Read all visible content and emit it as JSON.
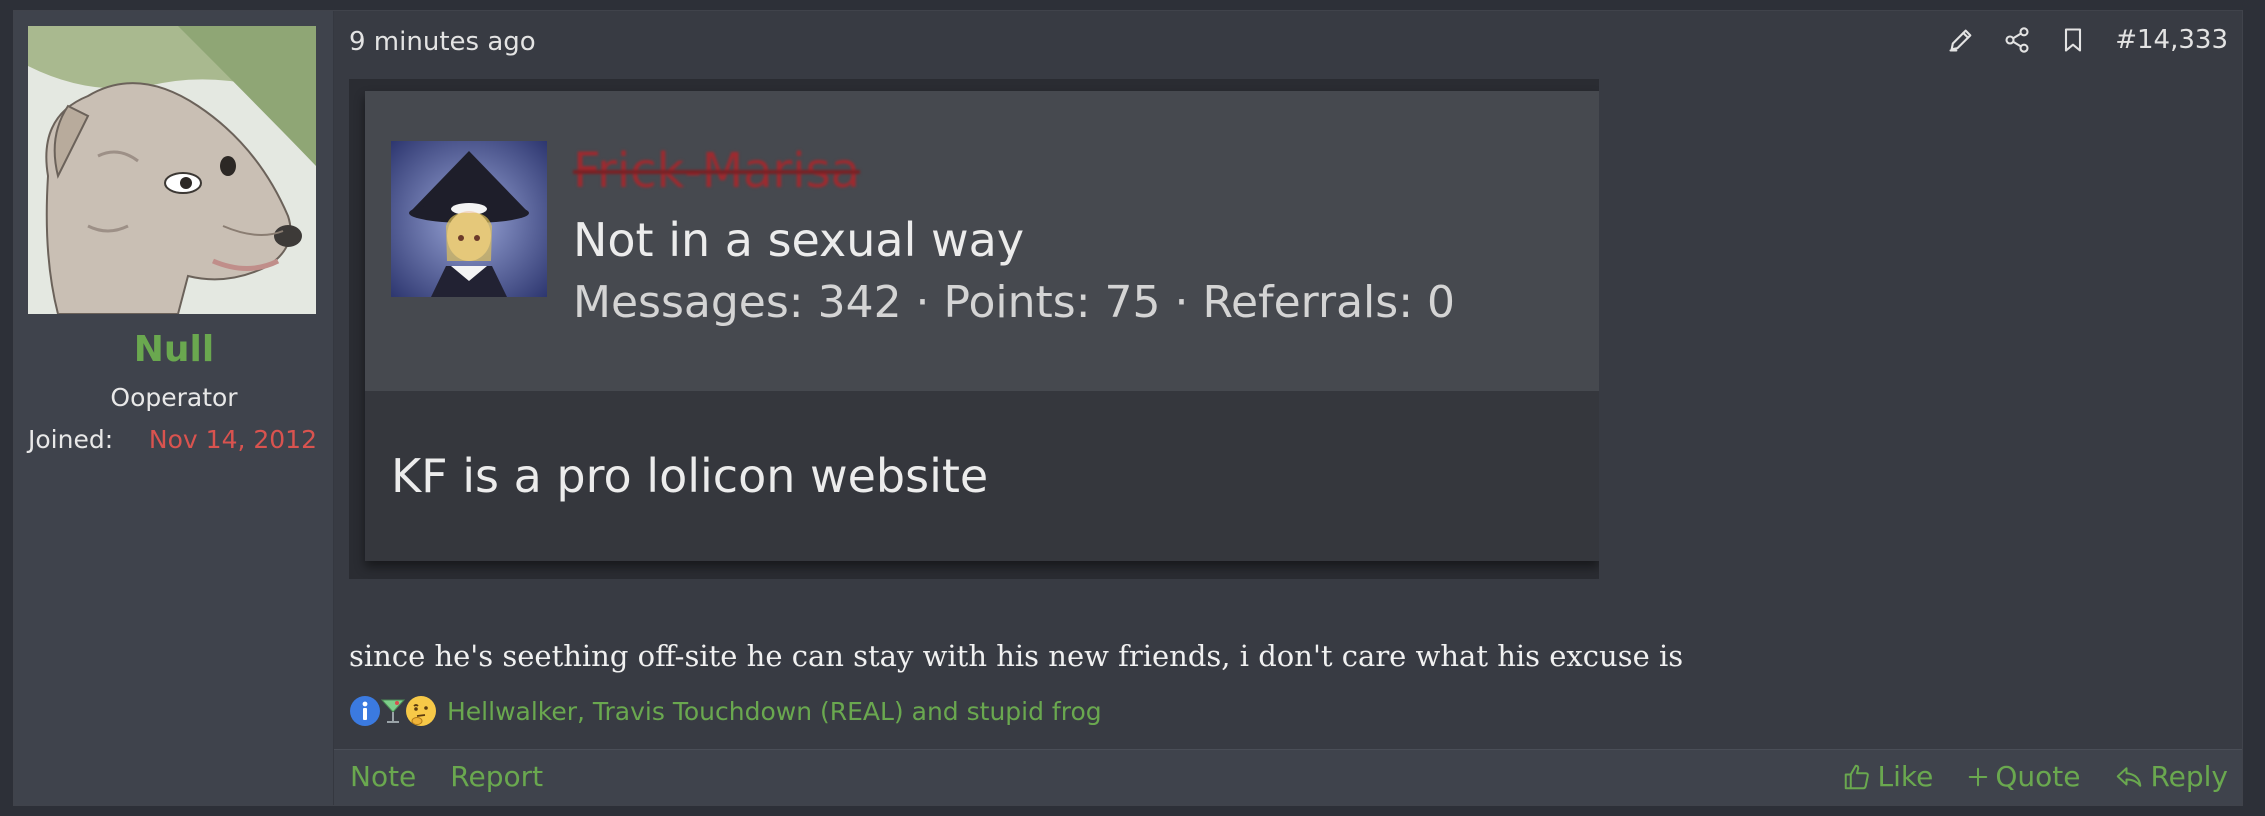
{
  "user": {
    "name": "Null",
    "title": "Ooperator",
    "joined_label": "Joined:",
    "joined_date": "Nov 14, 2012",
    "name_color": "#6aa84f",
    "joined_color": "#d9534f"
  },
  "post": {
    "timestamp": "9 minutes ago",
    "number": "#14,333",
    "message": "since he's seething off-site he can stay with his new friends, i don't care what his excuse is",
    "top_icons": [
      "edit-pencil-icon",
      "share-icon",
      "bookmark-icon"
    ]
  },
  "embed": {
    "name": "Frick-Marisa",
    "title": "Not in a sexual way",
    "stats": "Messages: 342 · Points: 75 · Referrals: 0",
    "body": "KF is a pro lolicon website",
    "name_color": "#9e2a2f"
  },
  "reactions": {
    "icons": [
      "informative-icon",
      "cocktail-icon",
      "thinking-icon"
    ],
    "names": "Hellwalker, Travis Touchdown (REAL) and stupid frog"
  },
  "footer": {
    "note": "Note",
    "report": "Report",
    "like": "Like",
    "quote": "Quote",
    "reply": "Reply",
    "link_color": "#6aa84f"
  }
}
